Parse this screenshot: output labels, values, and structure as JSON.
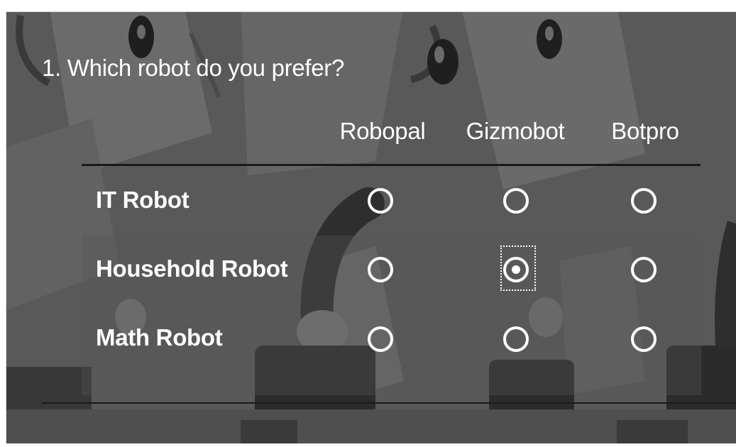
{
  "question": {
    "title": "1. Which robot do you prefer?"
  },
  "columns": [
    {
      "label": "Robopal"
    },
    {
      "label": "Gizmobot"
    },
    {
      "label": "Botpro"
    }
  ],
  "rows": [
    {
      "label": "IT Robot",
      "selected": null
    },
    {
      "label": "Household Robot",
      "selected": "Gizmobot"
    },
    {
      "label": "Math Robot",
      "selected": null
    }
  ],
  "colors": {
    "background": "#5a5a5a",
    "text": "#ffffff",
    "rule": "#1a1a1a"
  }
}
